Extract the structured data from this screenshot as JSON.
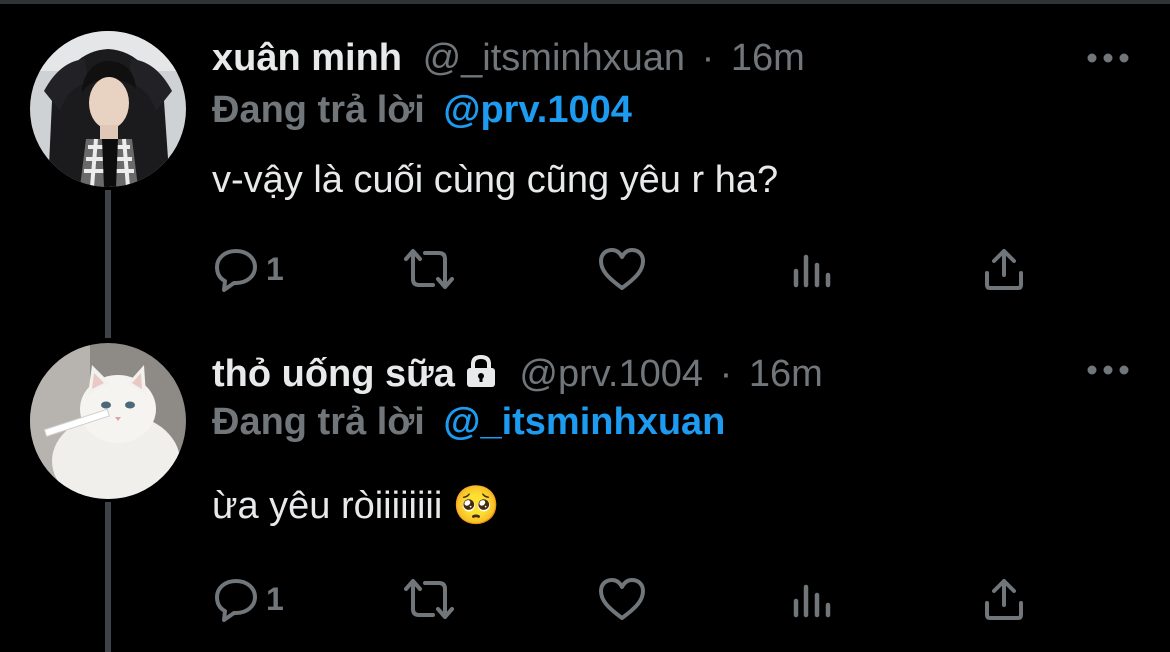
{
  "tweets": [
    {
      "display_name": "xuân minh",
      "handle": "@_itsminhxuan",
      "separator": "·",
      "time": "16m",
      "reply_prefix": "Đang trả lời",
      "reply_target": "@prv.1004",
      "text": "v-vậy là cuối cùng cũng yêu r ha?",
      "reply_count": "1",
      "protected": false
    },
    {
      "display_name": "thỏ uống sữa",
      "handle": "@prv.1004",
      "separator": "·",
      "time": "16m",
      "reply_prefix": "Đang trả lời",
      "reply_target": "@_itsminhxuan",
      "text": "ừa yêu ròiiiiiiii 🥺",
      "reply_count": "1",
      "protected": true
    }
  ],
  "icons": {
    "reply": "reply-icon",
    "retweet": "retweet-icon",
    "like": "heart-icon",
    "views": "bar-chart-icon",
    "share": "share-icon",
    "more": "more-dots-icon",
    "protected": "lock-icon"
  },
  "colors": {
    "background": "#000000",
    "primary_text": "#e7e9ea",
    "secondary_text": "#71767b",
    "link": "#1d9bf0",
    "thread_line": "#3d4348"
  }
}
